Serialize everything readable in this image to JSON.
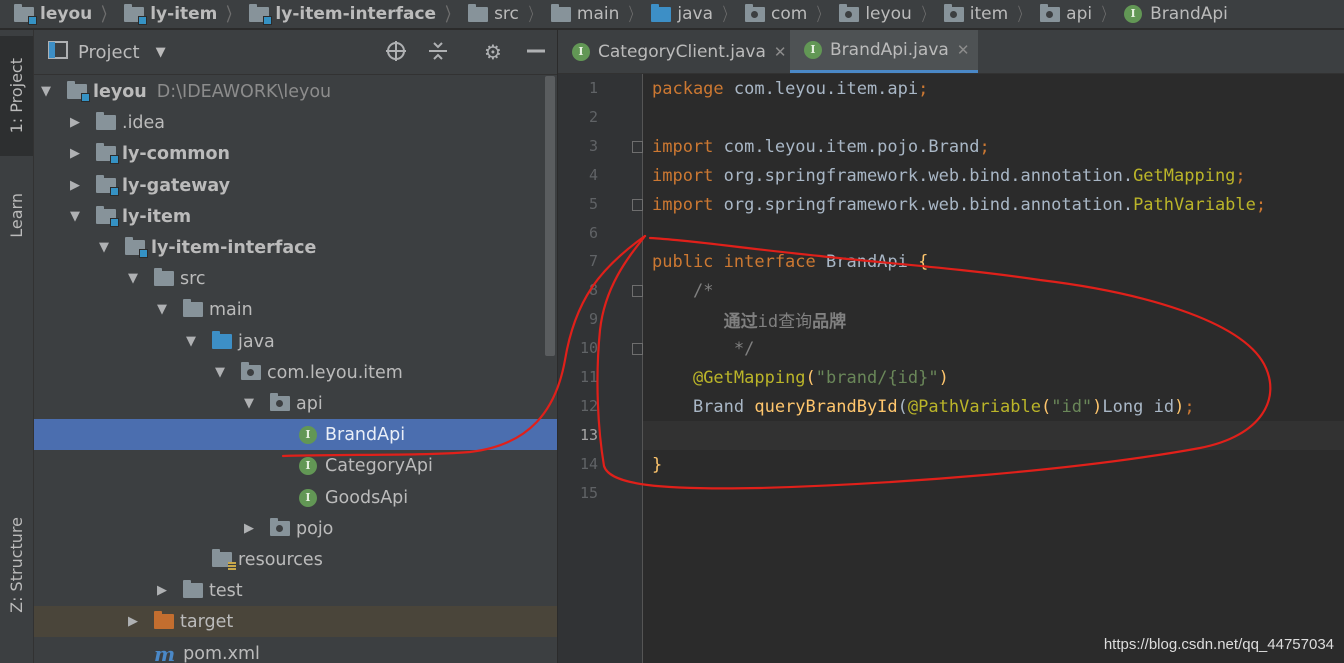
{
  "breadcrumb": [
    {
      "label": "leyou",
      "icon": "module-folder-icon",
      "bold": true
    },
    {
      "label": "ly-item",
      "icon": "module-folder-icon",
      "bold": true
    },
    {
      "label": "ly-item-interface",
      "icon": "module-folder-icon",
      "bold": true
    },
    {
      "label": "src",
      "icon": "folder-icon",
      "bold": false
    },
    {
      "label": "main",
      "icon": "folder-icon",
      "bold": false
    },
    {
      "label": "java",
      "icon": "source-folder-icon",
      "bold": false
    },
    {
      "label": "com",
      "icon": "package-icon",
      "bold": false
    },
    {
      "label": "leyou",
      "icon": "package-icon",
      "bold": false
    },
    {
      "label": "item",
      "icon": "package-icon",
      "bold": false
    },
    {
      "label": "api",
      "icon": "package-icon",
      "bold": false
    },
    {
      "label": "BrandApi",
      "icon": "interface-icon",
      "bold": false
    }
  ],
  "tool_strip": {
    "project_tab": "1: Project",
    "learn_tab": "Learn",
    "structure_tab": "Z: Structure"
  },
  "project_panel": {
    "title": "Project",
    "tree": [
      {
        "label": "leyou",
        "path": "D:\\IDEAWORK\\leyou",
        "depth": 0,
        "expanded": true,
        "icon": "module",
        "bold": true
      },
      {
        "label": ".idea",
        "depth": 1,
        "expanded": false,
        "icon": "folder",
        "bold": false
      },
      {
        "label": "ly-common",
        "depth": 1,
        "expanded": false,
        "icon": "module",
        "bold": true
      },
      {
        "label": "ly-gateway",
        "depth": 1,
        "expanded": false,
        "icon": "module",
        "bold": true
      },
      {
        "label": "ly-item",
        "depth": 1,
        "expanded": true,
        "icon": "module",
        "bold": true
      },
      {
        "label": "ly-item-interface",
        "depth": 2,
        "expanded": true,
        "icon": "module",
        "bold": true
      },
      {
        "label": "src",
        "depth": 3,
        "expanded": true,
        "icon": "folder",
        "bold": false
      },
      {
        "label": "main",
        "depth": 4,
        "expanded": true,
        "icon": "folder",
        "bold": false
      },
      {
        "label": "java",
        "depth": 5,
        "expanded": true,
        "icon": "source",
        "bold": false
      },
      {
        "label": "com.leyou.item",
        "depth": 6,
        "expanded": true,
        "icon": "package",
        "bold": false
      },
      {
        "label": "api",
        "depth": 7,
        "expanded": true,
        "icon": "package",
        "bold": false
      },
      {
        "label": "BrandApi",
        "depth": 8,
        "leaf": true,
        "icon": "interface",
        "bold": false,
        "selected": true
      },
      {
        "label": "CategoryApi",
        "depth": 8,
        "leaf": true,
        "icon": "interface",
        "bold": false
      },
      {
        "label": "GoodsApi",
        "depth": 8,
        "leaf": true,
        "icon": "interface",
        "bold": false
      },
      {
        "label": "pojo",
        "depth": 7,
        "expanded": false,
        "icon": "package",
        "bold": false
      },
      {
        "label": "resources",
        "depth": 5,
        "leaf": true,
        "icon": "resources",
        "bold": false
      },
      {
        "label": "test",
        "depth": 4,
        "expanded": false,
        "icon": "folder",
        "bold": false
      },
      {
        "label": "target",
        "depth": 3,
        "expanded": false,
        "icon": "target",
        "bold": false
      },
      {
        "label": "pom.xml",
        "depth": 3,
        "leaf": true,
        "icon": "maven",
        "bold": false
      }
    ]
  },
  "editor": {
    "tabs": [
      {
        "label": "CategoryClient.java",
        "active": false
      },
      {
        "label": "BrandApi.java",
        "active": true
      }
    ],
    "current_line": 13,
    "lines": [
      [
        [
          "kw",
          "package "
        ],
        [
          "ident",
          "com.leyou.item.api"
        ],
        [
          "kw",
          ";"
        ]
      ],
      [],
      [
        [
          "kw",
          "import "
        ],
        [
          "ident",
          "com.leyou.item.pojo.Brand"
        ],
        [
          "kw",
          ";"
        ]
      ],
      [
        [
          "kw",
          "import "
        ],
        [
          "ident",
          "org.springframework.web.bind.annotation."
        ],
        [
          "anntype",
          "GetMapping"
        ],
        [
          "kw",
          ";"
        ]
      ],
      [
        [
          "kw",
          "import "
        ],
        [
          "ident",
          "org.springframework.web.bind.annotation."
        ],
        [
          "anntype",
          "PathVariable"
        ],
        [
          "kw",
          ";"
        ]
      ],
      [],
      [
        [
          "kw",
          "public interface "
        ],
        [
          "ident",
          "BrandApi "
        ],
        [
          "meth",
          "{"
        ]
      ],
      [
        [
          "ident",
          "    "
        ],
        [
          "cmt",
          "/*"
        ]
      ],
      [
        [
          "ident",
          "       "
        ],
        [
          "cmt-b",
          "通过"
        ],
        [
          "cmt",
          "id查询"
        ],
        [
          "cmt-b",
          "品牌"
        ]
      ],
      [
        [
          "ident",
          "        "
        ],
        [
          "cmt",
          "*/"
        ]
      ],
      [
        [
          "ident",
          "    "
        ],
        [
          "ann",
          "@GetMapping"
        ],
        [
          "meth",
          "("
        ],
        [
          "str",
          "\"brand/{id}\""
        ],
        [
          "meth",
          ")"
        ]
      ],
      [
        [
          "ident",
          "    Brand "
        ],
        [
          "meth",
          "queryBrandById"
        ],
        [
          "ident",
          "("
        ],
        [
          "ann",
          "@PathVariable"
        ],
        [
          "meth",
          "("
        ],
        [
          "str",
          "\"id\""
        ],
        [
          "meth",
          ")"
        ],
        [
          "ident",
          "Long id"
        ],
        [
          "meth",
          ")"
        ],
        [
          "kw",
          ";"
        ]
      ],
      [],
      [
        [
          "meth",
          "}"
        ]
      ],
      []
    ]
  },
  "watermark": "https://blog.csdn.net/qq_44757034"
}
